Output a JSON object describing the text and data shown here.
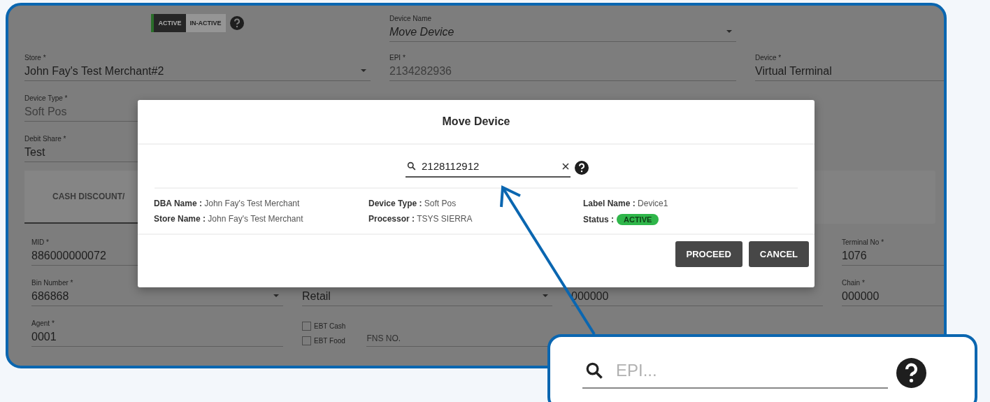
{
  "status_toggle": [
    {
      "label": "ACTIVE",
      "selected": true
    },
    {
      "label": "IN-ACTIVE",
      "selected": false
    }
  ],
  "device_name": {
    "label": "Device Name",
    "value": "Move Device"
  },
  "top_fields": [
    {
      "kind": "select",
      "label": "Store *",
      "value": "John Fay's Test Merchant#2"
    },
    {
      "kind": "disabled",
      "label": "EPI *",
      "value": "2134282936"
    },
    {
      "kind": "text",
      "label": "Device *",
      "value": "Virtual Terminal"
    },
    {
      "kind": "disabled",
      "label": "Device Type *",
      "value": "Soft Pos"
    },
    {
      "kind": "empty"
    },
    {
      "kind": "empty"
    },
    {
      "kind": "text",
      "label": "Debit Share *",
      "value": "Test"
    }
  ],
  "tab": {
    "label": "CASH DISCOUNT/"
  },
  "lower_fields": [
    {
      "kind": "text",
      "label": "MID *",
      "value": "886000000072"
    },
    {
      "kind": "empty"
    },
    {
      "kind": "empty"
    },
    {
      "kind": "text",
      "label": "Terminal No *",
      "value": "1076"
    },
    {
      "kind": "select",
      "label": "Bin Number *",
      "value": "686868"
    },
    {
      "kind": "select",
      "value": "Retail"
    },
    {
      "kind": "text",
      "value": "000000"
    },
    {
      "kind": "text",
      "label": "Chain *",
      "value": "000000"
    },
    {
      "kind": "text",
      "label": "Agent *",
      "value": "0001"
    },
    {
      "kind": "checks",
      "checks": [
        {
          "label": "EBT Cash",
          "checked": false
        },
        {
          "label": "EBT Food",
          "checked": false
        }
      ],
      "placeholder": "FNS NO."
    }
  ],
  "modal": {
    "title": "Move Device",
    "search_value": "2128112912",
    "details": [
      [
        {
          "label": "DBA Name :",
          "value": "John Fay's Test Merchant"
        },
        {
          "label": "Store Name :",
          "value": "John Fay's Test Merchant"
        }
      ],
      [
        {
          "label": "Device Type :",
          "value": "Soft Pos"
        },
        {
          "label": "Processor :",
          "value": "TSYS SIERRA"
        }
      ],
      [
        {
          "label": "Label Name :",
          "value": "Device1"
        },
        {
          "label": "Status :",
          "value": "ACTIVE",
          "kind": "badge"
        }
      ]
    ],
    "buttons": [
      "PROCEED",
      "CANCEL"
    ]
  },
  "callout": {
    "placeholder": "EPI..."
  }
}
